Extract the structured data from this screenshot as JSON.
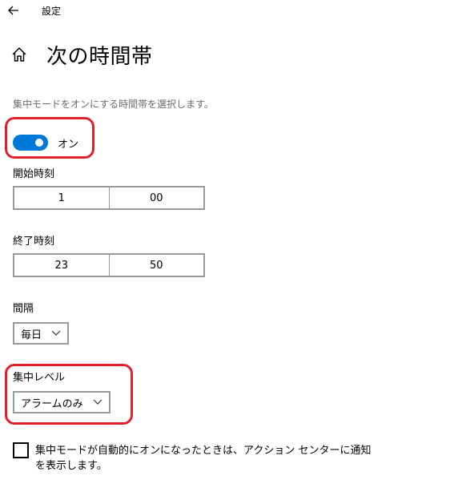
{
  "app": {
    "title": "設定",
    "back_icon": "back-arrow-icon"
  },
  "header": {
    "home_icon": "home-icon",
    "title": "次の時間帯"
  },
  "description": "集中モードをオンにする時間帯を選択します。",
  "toggle": {
    "state": true,
    "label": "オン",
    "accent_color": "#0078d7"
  },
  "start_time": {
    "label": "開始時刻",
    "hour": "1",
    "minute": "00"
  },
  "end_time": {
    "label": "終了時刻",
    "hour": "23",
    "minute": "50"
  },
  "interval": {
    "label": "間隔",
    "selected": "毎日"
  },
  "focus_level": {
    "label": "集中レベル",
    "selected": "アラームのみ"
  },
  "notify_checkbox": {
    "checked": false,
    "label": "集中モードが自動的にオンになったときは、アクション センターに通知を表示します。"
  },
  "annotation_color": "#e0202a"
}
